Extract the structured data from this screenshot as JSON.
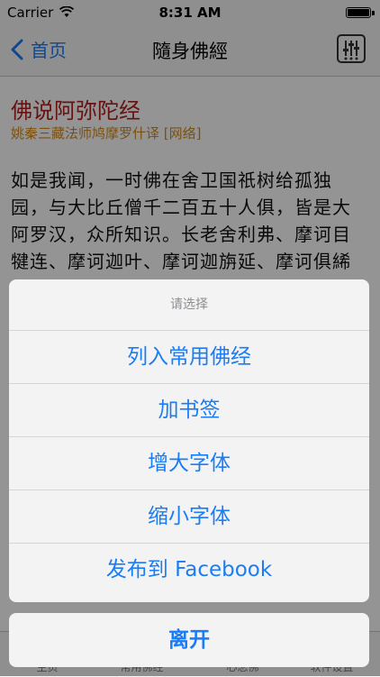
{
  "status": {
    "carrier": "Carrier",
    "time": "8:31 AM"
  },
  "nav": {
    "back_label": "首页",
    "title": "隨身佛經",
    "settings_icon": "sliders-icon"
  },
  "content": {
    "sutra_title": "佛说阿弥陀经",
    "translator": "姚秦三藏法师鸠摩罗什译 [网络]",
    "body_text": "如是我闻，一时佛在舍卫国祇树给孤独园，与大比丘僧千二百五十人俱，皆是大阿罗汉，众所知识。长老舍利弗、摩诃目犍连、摩诃迦叶、摩诃迦旃延、摩诃俱絺罗、离婆多、周利槃陀伽、难陀、阿难"
  },
  "tabs": [
    {
      "label": "主页"
    },
    {
      "label": "常用佛经"
    },
    {
      "label": "一心念佛"
    },
    {
      "label": "软件设置"
    }
  ],
  "sheet": {
    "title": "请选择",
    "buttons": [
      {
        "label": "列入常用佛经"
      },
      {
        "label": "加书签"
      },
      {
        "label": "增大字体"
      },
      {
        "label": "缩小字体"
      },
      {
        "label": "发布到 Facebook"
      }
    ],
    "cancel_label": "离开"
  },
  "colors": {
    "accent": "#1a7cf6",
    "title_red": "#b22020",
    "translator_orange": "#d28b1e"
  }
}
